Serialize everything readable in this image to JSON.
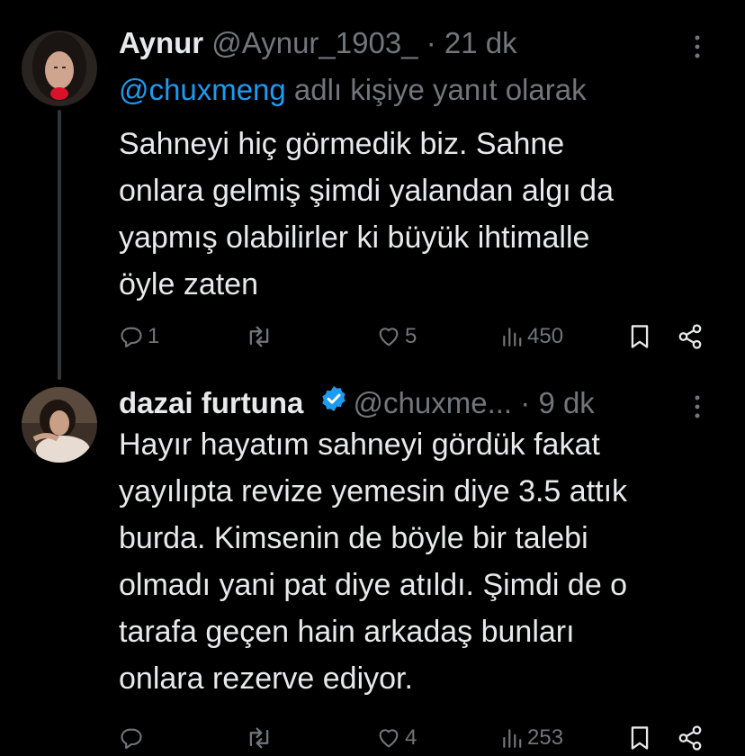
{
  "tweet1": {
    "name": "Aynur",
    "handle": "@Aynur_1903_",
    "separator": "·",
    "time": "21 dk",
    "reply_mention": "@chuxmeng",
    "reply_suffix": " adlı kişiye yanıt olarak",
    "lines": [
      "Sahneyi hiç görmedik biz. Sahne",
      "onlara gelmiş şimdi yalandan algı da",
      "yapmış olabilirler ki büyük ihtimalle",
      "öyle zaten"
    ],
    "replies": "1",
    "likes": "5",
    "views": "450"
  },
  "tweet2": {
    "name": "dazai furtuna",
    "handle": "@chuxme...",
    "separator": "·",
    "time": "9 dk",
    "lines": [
      "Hayır hayatım sahneyi gördük fakat",
      "yayılıpta revize yemesin diye 3.5 attık",
      "burda. Kimsenin de böyle bir talebi",
      "olmadı yani pat diye atıldı. Şimdi de o",
      "tarafa geçen hain arkadaş bunları",
      "onlara rezerve ediyor."
    ],
    "likes": "4",
    "views": "253"
  },
  "colors": {
    "background": "#000000",
    "text": "#e7e9ea",
    "muted": "#71767b",
    "accent": "#1d9bf0"
  },
  "icons": [
    "reply-icon",
    "retweet-icon",
    "like-icon",
    "views-icon",
    "bookmark-icon",
    "share-icon",
    "verified-badge-icon",
    "more-icon"
  ]
}
